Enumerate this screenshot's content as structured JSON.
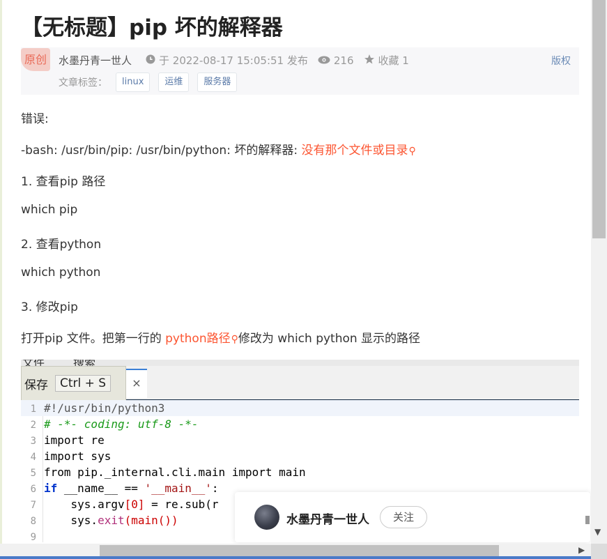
{
  "article": {
    "title": "【无标题】pip 坏的解释器",
    "badge": "原创",
    "author": "水墨丹青一世人",
    "publish_time": "于 2022-08-17 15:05:51 发布",
    "views": "216",
    "favorite": "收藏 1",
    "copyright": "版权",
    "tags_label": "文章标签：",
    "tags": [
      "linux",
      "运维",
      "服务器"
    ]
  },
  "body": {
    "p1": "错误:",
    "p2_prefix": "-bash: /usr/bin/pip: /usr/bin/python: 坏的解释器: ",
    "p2_link": "没有那个文件或目录",
    "p3": "1. 查看pip 路径",
    "p4": "which pip",
    "p5": "2. 查看python",
    "p6": "which python",
    "p7": "3. 修改pip",
    "p8_prefix": "打开pip 文件。把第一行的 ",
    "p8_link": "python路径",
    "p8_suffix": "修改为 which python 显示的路径"
  },
  "editor": {
    "menu_file": "文件",
    "menu_search": "搜索",
    "save_label": "保存",
    "save_shortcut": "Ctrl + S",
    "close_glyph": "×",
    "line_numbers": [
      "1",
      "2",
      "3",
      "4",
      "5",
      "6",
      "7",
      "8",
      "9"
    ],
    "lines": {
      "l1": "#!/usr/bin/python3",
      "l2": "# -*- coding: utf-8 -*-",
      "l3": "import re",
      "l4": "import sys",
      "l5": "from pip._internal.cli.main import main",
      "l6_kw": "if",
      "l6_a": " __name__ == ",
      "l6_str": "'__main__'",
      "l6_b": ":",
      "l7_a": "    sys.argv",
      "l7_b": "[",
      "l7_num": "0",
      "l7_c": "]",
      "l7_d": " = re.sub(r",
      "l8_a": "    sys.",
      "l8_fn": "exit",
      "l8_b": "(main())"
    }
  },
  "follow": {
    "name": "水墨丹青一世人",
    "button": "关注"
  },
  "icons": {
    "clock": "clock-icon",
    "eye": "eye-icon",
    "star": "star-icon",
    "search": "search-icon"
  },
  "colors": {
    "link_red": "#fc5531",
    "tag_blue": "#5a7aa8",
    "keyword": "#0033cc",
    "comment": "#1a9a1a"
  }
}
